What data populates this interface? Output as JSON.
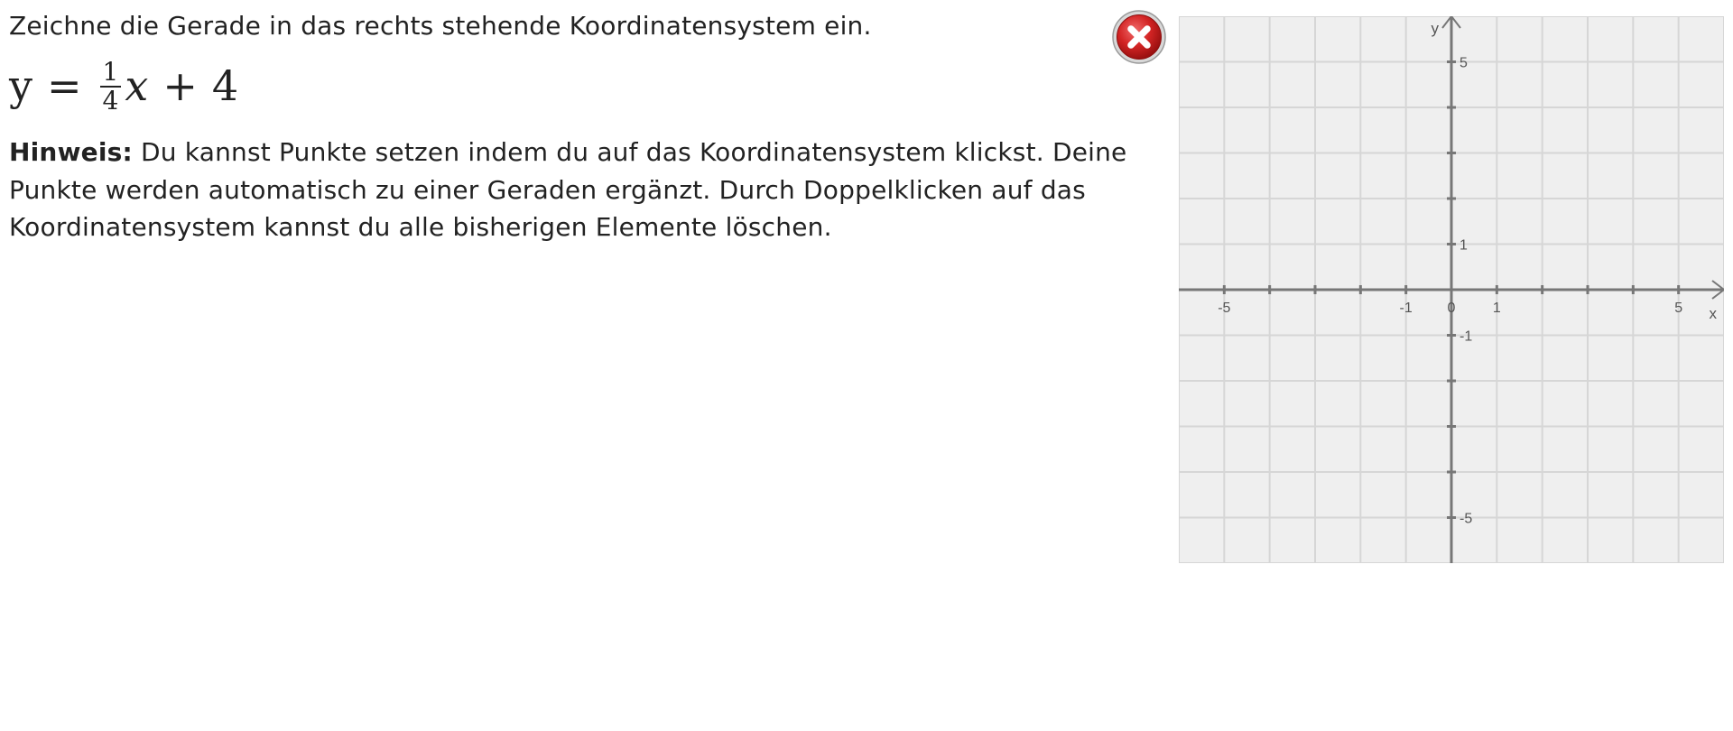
{
  "task": {
    "instruction": "Zeichne die Gerade in das rechts stehende Koordinatensystem ein.",
    "equation": {
      "lhs": "y",
      "equals": "=",
      "numerator": "1",
      "denominator": "4",
      "variable": "x",
      "plus": "+",
      "constant": "4"
    },
    "hint_label": "Hinweis:",
    "hint_text": " Du kannst Punkte setzen indem du auf das Koordinatensystem klickst. Deine Punkte werden automatisch zu einer Geraden ergänzt. Durch Doppelklicken auf das Koordinatensystem kannst du alle bisherigen Elemente löschen."
  },
  "close_button": {
    "icon": "close-icon",
    "color": "#cc1f1f"
  },
  "coordinate_system": {
    "x_axis_label": "x",
    "y_axis_label": "y",
    "x_range": [
      -6,
      6
    ],
    "y_range": [
      -6,
      6
    ],
    "grid": true,
    "x_tick_labels": [
      {
        "value": -5,
        "text": "-5"
      },
      {
        "value": -1,
        "text": "-1"
      },
      {
        "value": 0,
        "text": "0"
      },
      {
        "value": 1,
        "text": "1"
      },
      {
        "value": 5,
        "text": "5"
      }
    ],
    "y_tick_labels": [
      {
        "value": 5,
        "text": "5"
      },
      {
        "value": 1,
        "text": "1"
      },
      {
        "value": -1,
        "text": "-1"
      },
      {
        "value": -5,
        "text": "-5"
      }
    ],
    "background_color": "#efefef",
    "grid_color": "#d6d6d6",
    "axis_color": "#777777"
  }
}
